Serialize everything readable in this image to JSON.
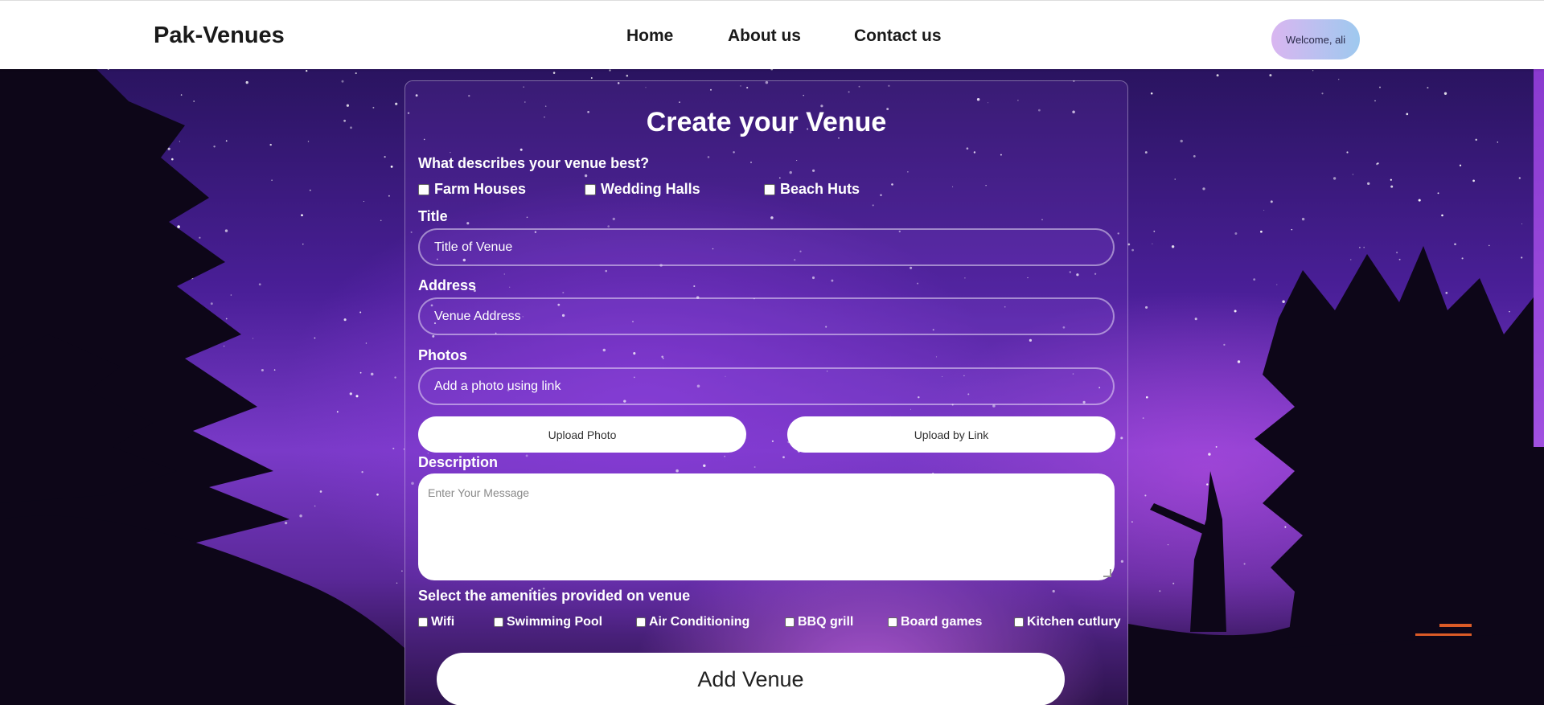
{
  "header": {
    "logo": "Pak-Venues",
    "nav": [
      "Home",
      "About us",
      "Contact us"
    ],
    "welcome": "Welcome, ali"
  },
  "form": {
    "title": "Create your Venue",
    "category_label": "What describes your venue best?",
    "categories": [
      "Farm Houses",
      "Wedding Halls",
      "Beach Huts"
    ],
    "title_label": "Title",
    "title_placeholder": "Title of Venue",
    "address_label": "Address",
    "address_placeholder": "Venue Address",
    "photos_label": "Photos",
    "photos_placeholder": "Add a photo using link",
    "upload_photo": "Upload Photo",
    "upload_link": "Upload by Link",
    "description_label": "Description",
    "description_placeholder": "Enter Your Message",
    "amenities_label": "Select the amenities provided on venue",
    "amenities": [
      "Wifi",
      "Swimming Pool",
      "Air Conditioning",
      "BBQ grill",
      "Board games",
      "Kitchen cutlury"
    ],
    "submit": "Add Venue"
  },
  "colors": {
    "header_bg": "#ffffff",
    "sky_accent": "#7a3ac8",
    "welcome_gradient": [
      "#d9b6f0",
      "#9ec9ef"
    ]
  }
}
